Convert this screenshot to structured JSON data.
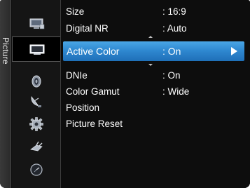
{
  "sidebar": {
    "label": "Picture"
  },
  "icons": [
    {
      "name": "picture-icon"
    },
    {
      "name": "display-icon"
    },
    {
      "name": "sound-icon"
    },
    {
      "name": "satellite-dish-icon"
    },
    {
      "name": "setup-gear-icon"
    },
    {
      "name": "input-plug-icon"
    },
    {
      "name": "support-clock-icon"
    }
  ],
  "menu": {
    "items": [
      {
        "label": "Size",
        "value": ": 16:9"
      },
      {
        "label": "Digital NR",
        "value": ": Auto"
      },
      {
        "label": "Active Color",
        "value": ": On"
      },
      {
        "label": "DNIe",
        "value": ": On"
      },
      {
        "label": "Color Gamut",
        "value": ": Wide"
      },
      {
        "label": "Position",
        "value": ""
      },
      {
        "label": "Picture Reset",
        "value": ""
      }
    ],
    "selected_index": 2
  },
  "colors": {
    "highlight": "#2f89d1",
    "background": "#0d0d0d",
    "text": "#ffffff"
  }
}
